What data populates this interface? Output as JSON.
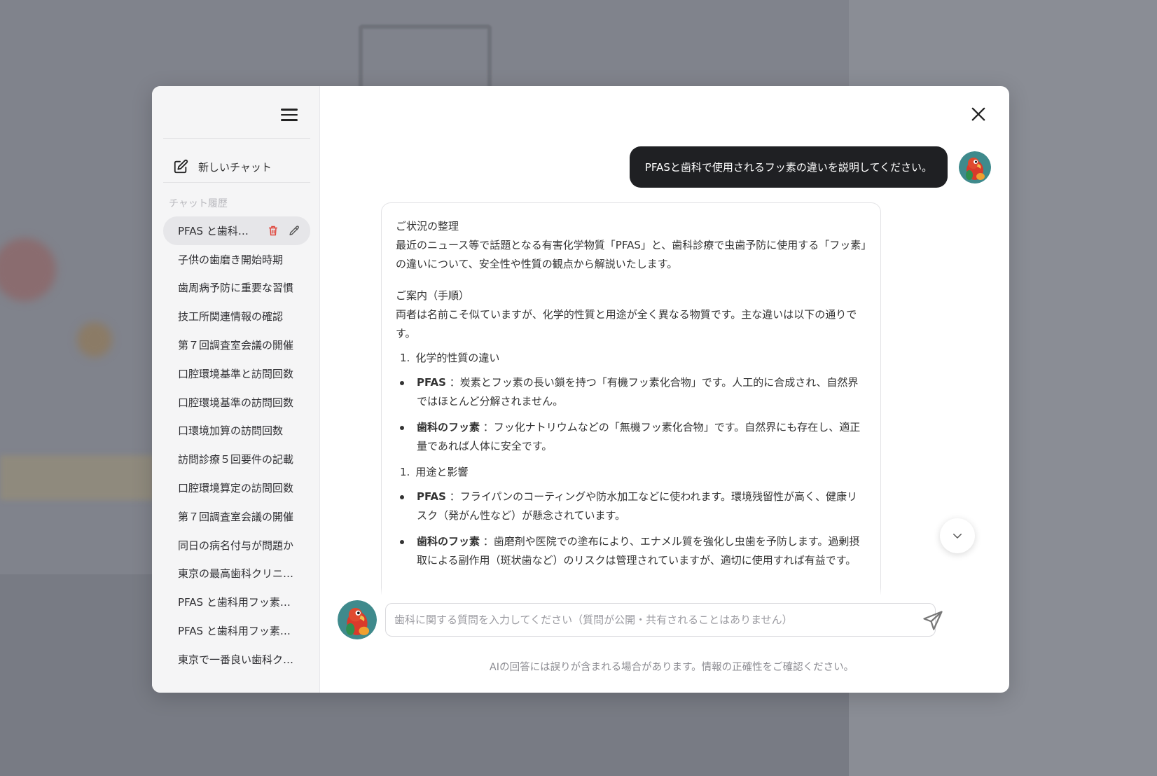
{
  "sidebar": {
    "new_chat_label": "新しいチャット",
    "history_title": "チャット履歴",
    "items": [
      {
        "label": "PFAS と歯科用フッ素の違い"
      },
      {
        "label": "子供の歯磨き開始時期"
      },
      {
        "label": "歯周病予防に重要な習慣"
      },
      {
        "label": "技工所関連情報の確認"
      },
      {
        "label": "第７回調査室会議の開催"
      },
      {
        "label": "口腔環境基準と訪問回数"
      },
      {
        "label": "口腔環境基準の訪問回数"
      },
      {
        "label": "口環境加算の訪問回数"
      },
      {
        "label": "訪問診療５回要件の記載"
      },
      {
        "label": "口腔環境算定の訪問回数"
      },
      {
        "label": "第７回調査室会議の開催"
      },
      {
        "label": "同日の病名付与が問題か"
      },
      {
        "label": "東京の最高歯科クリニック"
      },
      {
        "label": "PFAS と歯科用フッ素の違い"
      },
      {
        "label": "PFAS と歯科用フッ素の違い"
      },
      {
        "label": "東京で一番良い歯科クリニック"
      }
    ]
  },
  "conversation": {
    "user_message": "PFASと歯科で使用されるフッ素の違いを説明してください。",
    "answer": {
      "s1_title": "ご状況の整理",
      "s1_body": "最近のニュース等で話題となる有害化学物質「PFAS」と、歯科診療で虫歯予防に使用する「フッ素」の違いについて、安全性や性質の観点から解説いたします。",
      "s2_title": "ご案内（手順）",
      "s2_body": "両者は名前こそ似ていますが、化学的性質と用途が全く異なる物質です。主な違いは以下の通りです。",
      "list1_num": "1.",
      "list1_title": "化学的性質の違い",
      "b1_term": "PFAS",
      "b1_text": "：炭素とフッ素の長い鎖を持つ「有機フッ素化合物」です。人工的に合成され、自然界ではほとんど分解されません。",
      "b2_term": "歯科のフッ素",
      "b2_text": "：フッ化ナトリウムなどの「無機フッ素化合物」です。自然界にも存在し、適正量であれば人体に安全です。",
      "list2_num": "1.",
      "list2_title": "用途と影響",
      "b3_term": "PFAS",
      "b3_text": "：フライパンのコーティングや防水加工などに使われます。環境残留性が高く、健康リスク（発がん性など）が懸念されています。",
      "b4_term": "歯科のフッ素",
      "b4_text": "：歯磨剤や医院での塗布により、エナメル質を強化し虫歯を予防します。過剰摂取による副作用（斑状歯など）のリスクは管理されていますが、適切に使用すれば有益です。"
    }
  },
  "input": {
    "placeholder": "歯科に関する質問を入力してください（質問が公開・共有されることはありません）",
    "value": ""
  },
  "disclaimer": "AIの回答には誤りが含まれる場合があります。情報の正確性をご確認ください。",
  "icons": {
    "menu": "menu-icon",
    "new_chat": "edit-icon",
    "delete": "trash-icon",
    "rename": "pencil-icon",
    "close": "close-icon",
    "scroll_down": "chevron-down-icon",
    "send": "send-icon"
  },
  "colors": {
    "user_bubble": "#1f2023",
    "delete_icon": "#e0443a",
    "sidebar_bg": "#f5f5f6"
  }
}
